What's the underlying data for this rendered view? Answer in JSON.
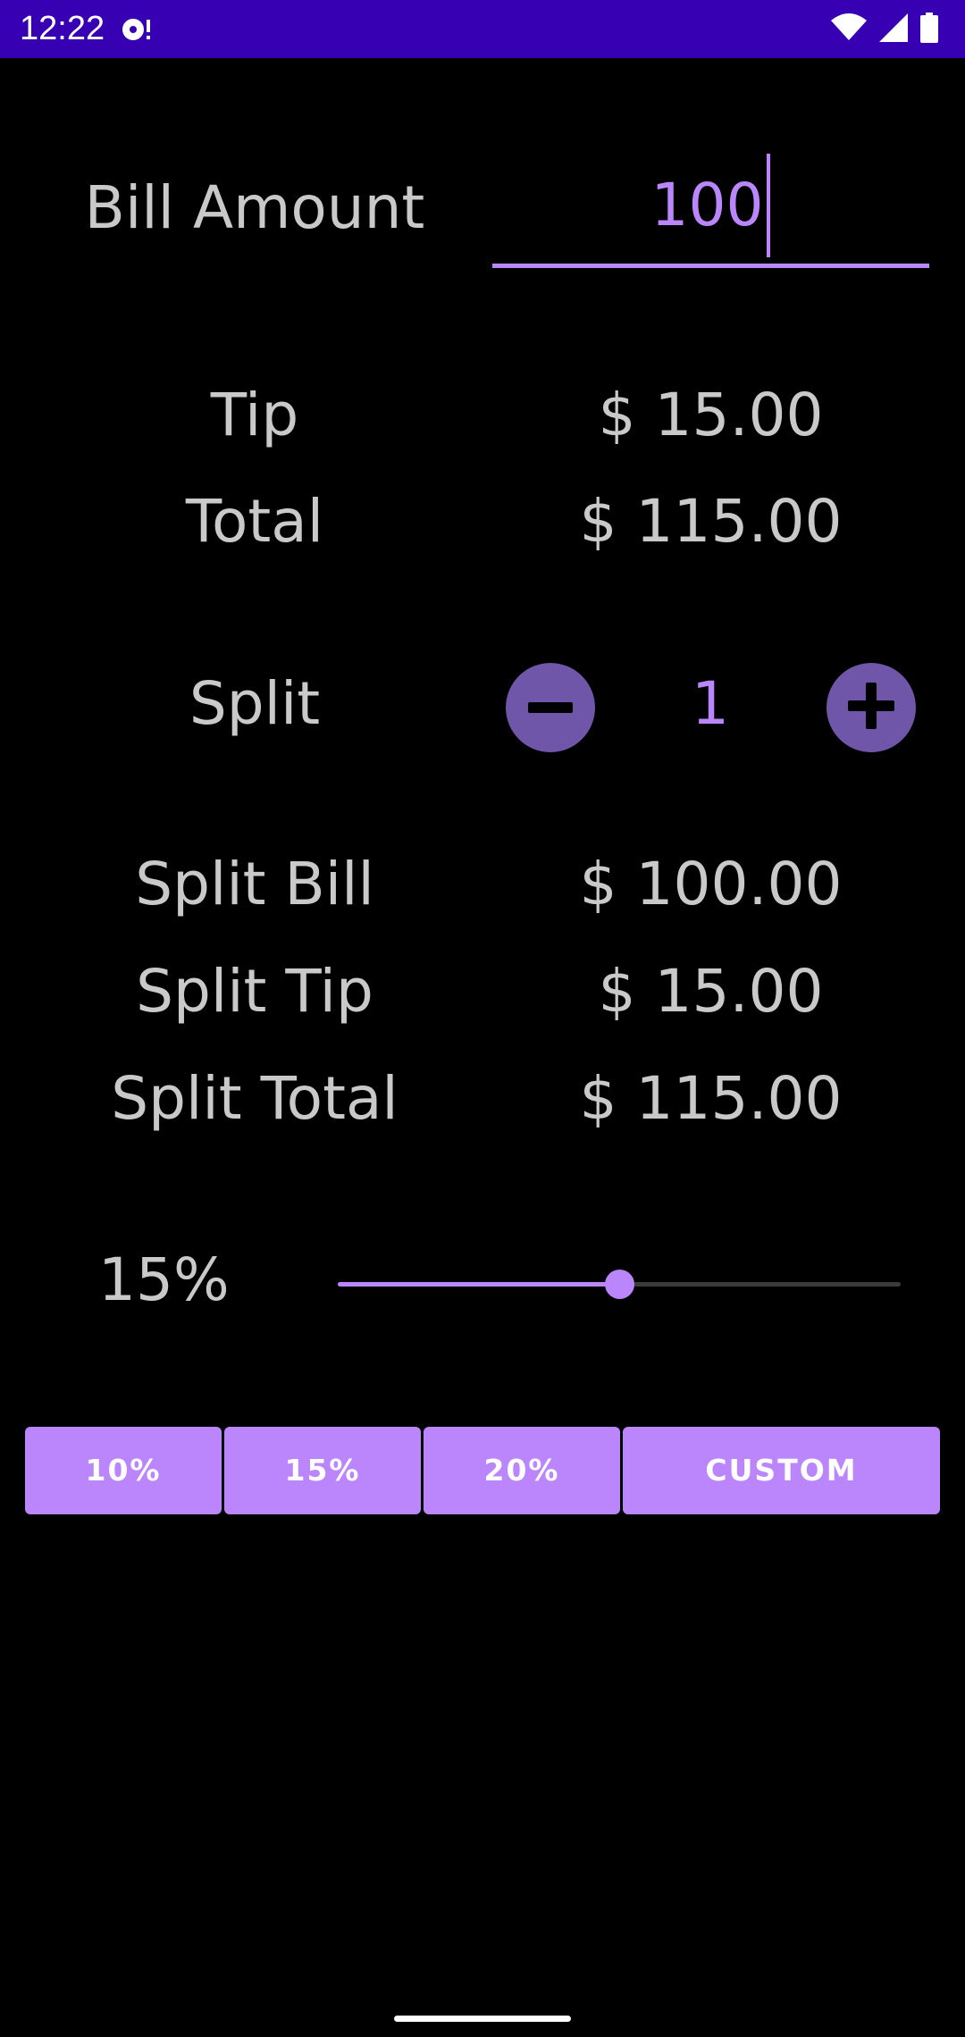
{
  "status_bar": {
    "time": "12:22",
    "notification_icon": "media-notification-icon",
    "wifi_icon": "wifi-icon",
    "signal_icon": "cell-signal-icon",
    "battery_icon": "battery-icon",
    "bar_color": "#3700b3"
  },
  "bill": {
    "label": "Bill Amount",
    "value": "100"
  },
  "tip": {
    "label": "Tip",
    "value": "$ 15.00"
  },
  "total": {
    "label": "Total",
    "value": "$ 115.00"
  },
  "split": {
    "label": "Split",
    "count": "1",
    "decrement_icon": "minus-icon",
    "increment_icon": "plus-icon"
  },
  "split_bill": {
    "label": "Split Bill",
    "value": "$ 100.00"
  },
  "split_tip": {
    "label": "Split Tip",
    "value": "$ 15.00"
  },
  "split_total": {
    "label": "Split Total",
    "value": "$ 115.00"
  },
  "tip_slider": {
    "label": "15%",
    "fraction": 0.5
  },
  "presets": {
    "p10": "10%",
    "p15": "15%",
    "p20": "20%",
    "custom": "CUSTOM"
  },
  "colors": {
    "accent": "#bb86fc",
    "text": "#c9c9c9",
    "round_button": "#6f56a9",
    "background": "#000000"
  }
}
